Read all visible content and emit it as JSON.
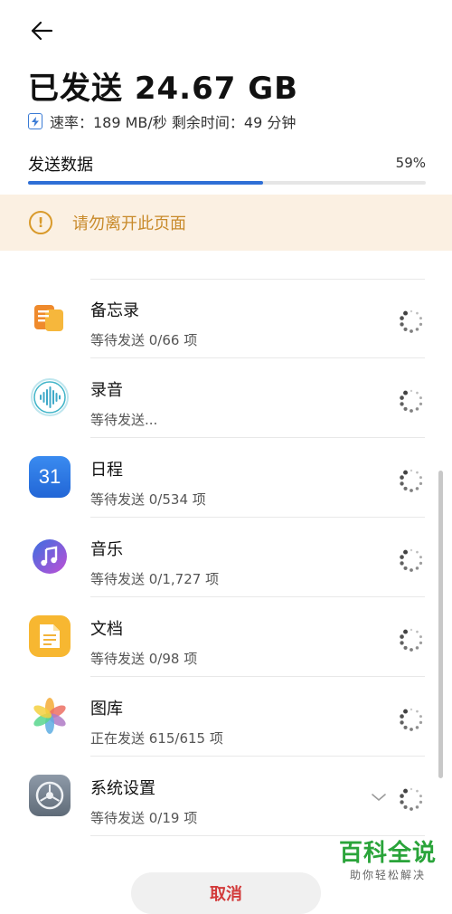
{
  "header": {
    "title": "已发送 24.67 GB",
    "speed_text": "速率：189 MB/秒  剩余时间：49 分钟"
  },
  "progress": {
    "label": "发送数据",
    "percent_text": "59%",
    "fraction": 0.59
  },
  "warning": {
    "icon_glyph": "!",
    "text": "请勿离开此页面"
  },
  "items": [
    {
      "name": "备忘录",
      "status": "等待发送 0/66 项",
      "icon": "notes-icon"
    },
    {
      "name": "录音",
      "status": "等待发送...",
      "icon": "recorder-icon"
    },
    {
      "name": "日程",
      "status": "等待发送 0/534 项",
      "icon": "calendar-icon",
      "icon_text": "31"
    },
    {
      "name": "音乐",
      "status": "等待发送 0/1,727 项",
      "icon": "music-icon"
    },
    {
      "name": "文档",
      "status": "等待发送 0/98 项",
      "icon": "documents-icon"
    },
    {
      "name": "图库",
      "status": "正在发送 615/615 项",
      "icon": "gallery-icon"
    },
    {
      "name": "系统设置",
      "status": "等待发送 0/19 项",
      "icon": "settings-icon"
    }
  ],
  "footer": {
    "cancel_label": "取消"
  },
  "watermark": {
    "brand": "百科全说",
    "tagline": "助你轻松解决"
  },
  "colors": {
    "accent": "#2f6fd6",
    "warning_bg": "#fbf0e2",
    "warning_text": "#c88a2a",
    "cancel_text": "#d23a3a",
    "watermark_green": "#2aa43a"
  }
}
